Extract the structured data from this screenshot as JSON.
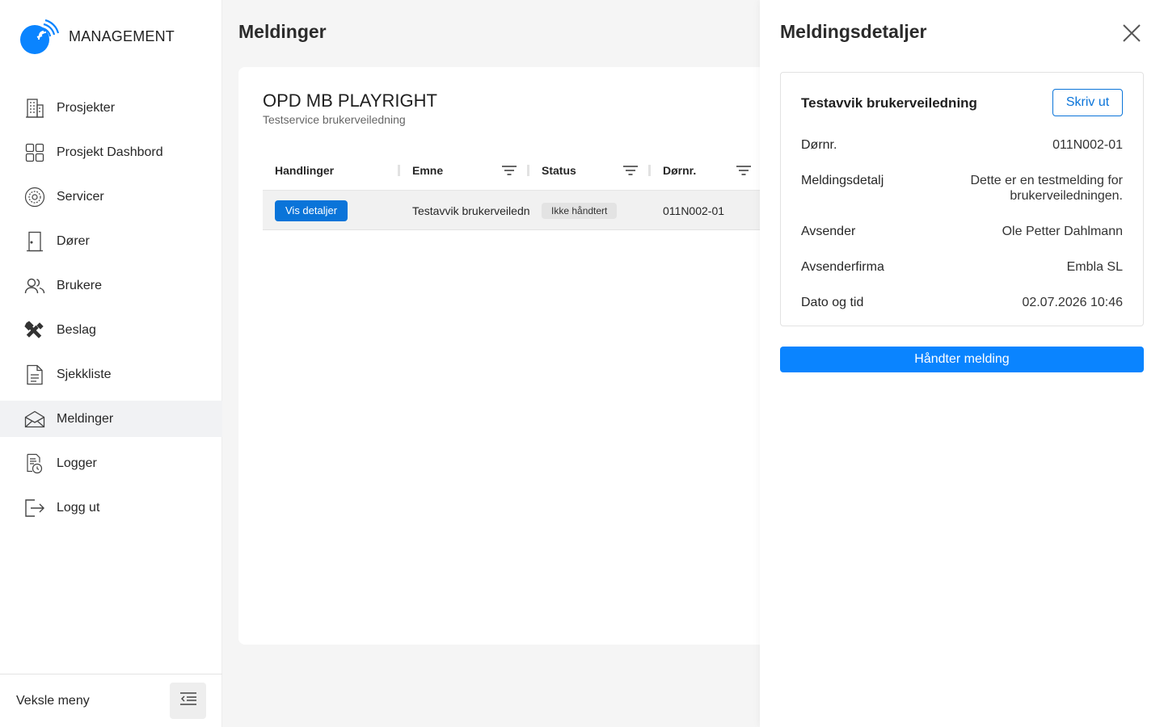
{
  "brand": {
    "name": "MANAGEMENT"
  },
  "sidebar": {
    "items": [
      {
        "label": "Prosjekter",
        "icon": "building-icon"
      },
      {
        "label": "Prosjekt Dashbord",
        "icon": "grid-icon"
      },
      {
        "label": "Servicer",
        "icon": "service-gear-icon"
      },
      {
        "label": "Dører",
        "icon": "door-icon"
      },
      {
        "label": "Brukere",
        "icon": "users-icon"
      },
      {
        "label": "Beslag",
        "icon": "tools-icon"
      },
      {
        "label": "Sjekkliste",
        "icon": "document-icon"
      },
      {
        "label": "Meldinger",
        "icon": "envelope-icon",
        "active": true
      },
      {
        "label": "Logger",
        "icon": "log-clock-icon"
      },
      {
        "label": "Logg ut",
        "icon": "logout-icon"
      }
    ],
    "footer": {
      "label": "Veksle meny"
    }
  },
  "main": {
    "title": "Meldinger",
    "card": {
      "title": "OPD MB PLAYRIGHT",
      "subtitle": "Testservice brukerveiledning"
    },
    "table": {
      "columns": [
        "Handlinger",
        "Emne",
        "Status",
        "Dørnr."
      ],
      "rows": [
        {
          "action": "Vis detaljer",
          "subject": "Testavvik brukerveiledn",
          "status": "Ikke håndtert",
          "door": "011N002-01"
        }
      ]
    }
  },
  "panel": {
    "title": "Meldingsdetaljer",
    "detail": {
      "heading": "Testavvik brukerveiledning",
      "print_label": "Skriv ut",
      "rows": [
        {
          "label": "Dørnr.",
          "value": "011N002-01"
        },
        {
          "label": "Meldingsdetalj",
          "value_line1": "Dette er en testmelding for",
          "value_line2": "brukerveiledningen."
        },
        {
          "label": "Avsender",
          "value": "Ole Petter Dahlmann"
        },
        {
          "label": "Avsenderfirma",
          "value": "Embla SL"
        },
        {
          "label": "Dato og tid",
          "value": "02.07.2026 10:46"
        }
      ]
    },
    "action_label": "Håndter melding"
  },
  "colors": {
    "primary": "#0a84ff",
    "button_dark": "#0a74d9",
    "brand_blue": "#0a84ff"
  }
}
